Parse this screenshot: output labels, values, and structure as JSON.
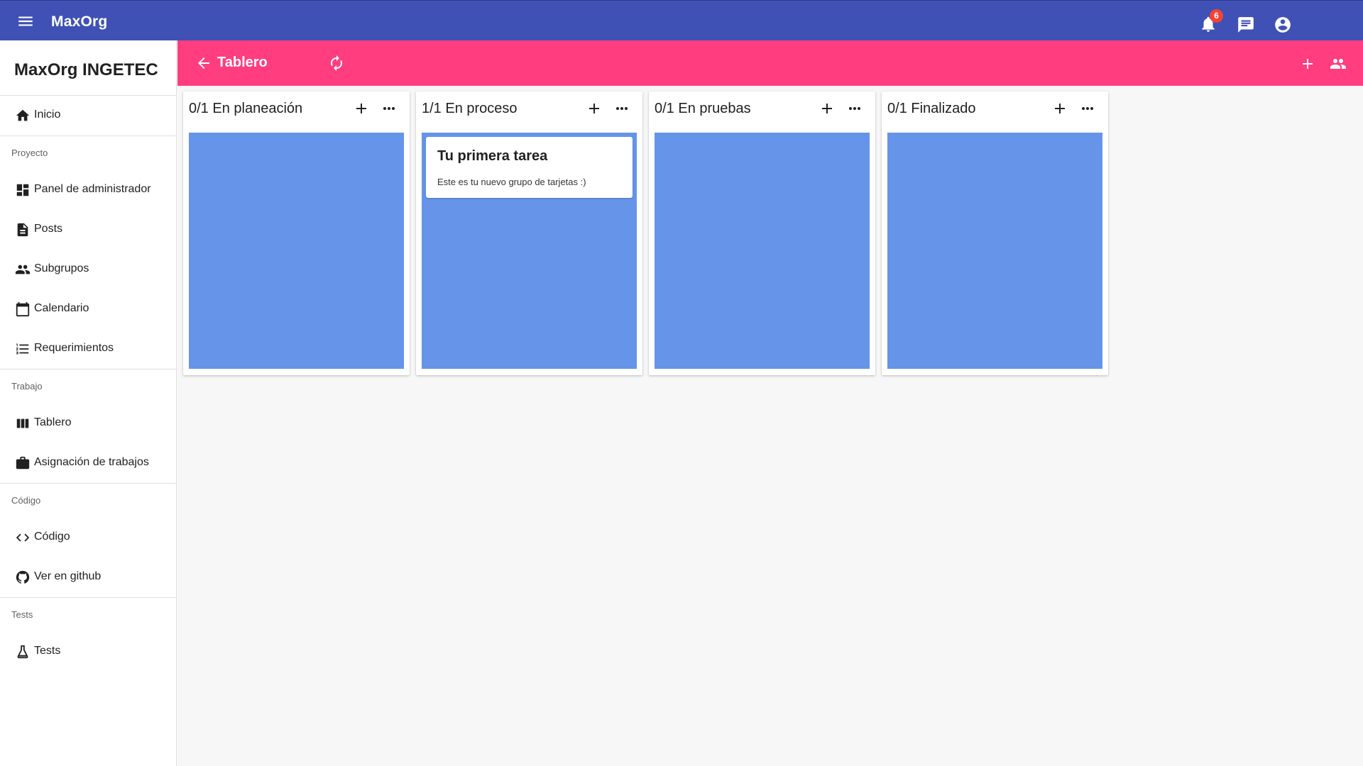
{
  "appbar": {
    "title": "MaxOrg",
    "notification_count": "6",
    "icons": [
      "menu-icon",
      "bell-icon",
      "chat-icon",
      "account-circle-icon"
    ],
    "color": "#3f51b5"
  },
  "sidebar": {
    "org_title": "MaxOrg INGETEC",
    "home_label": "Inicio",
    "sections": [
      {
        "header": "Proyecto",
        "items": [
          {
            "label": "Panel de administrador",
            "icon": "dashboard-icon"
          },
          {
            "label": "Posts",
            "icon": "document-icon"
          },
          {
            "label": "Subgrupos",
            "icon": "people-icon"
          },
          {
            "label": "Calendario",
            "icon": "calendar-icon"
          },
          {
            "label": "Requerimientos",
            "icon": "list-icon"
          }
        ]
      },
      {
        "header": "Trabajo",
        "items": [
          {
            "label": "Tablero",
            "icon": "columns-icon"
          },
          {
            "label": "Asignación de trabajos",
            "icon": "briefcase-icon"
          }
        ]
      },
      {
        "header": "Código",
        "items": [
          {
            "label": "Código",
            "icon": "code-icon"
          },
          {
            "label": "Ver en github",
            "icon": "github-icon"
          }
        ]
      },
      {
        "header": "Tests",
        "items": [
          {
            "label": "Tests",
            "icon": "flask-icon"
          }
        ]
      }
    ]
  },
  "toolbar": {
    "title": "Tablero",
    "color": "#ff3d7f",
    "icons": [
      "arrow-back-icon",
      "refresh-icon",
      "plus-icon",
      "group-icon"
    ]
  },
  "board": {
    "lane_color": "#6694e9",
    "columns": [
      {
        "title": "0/1 En planeación",
        "cards": []
      },
      {
        "title": "1/1 En proceso",
        "cards": [
          {
            "title": "Tu primera tarea",
            "description": "Este es tu nuevo grupo de tarjetas :)"
          }
        ]
      },
      {
        "title": "0/1 En pruebas",
        "cards": []
      },
      {
        "title": "0/1 Finalizado",
        "cards": []
      }
    ]
  }
}
